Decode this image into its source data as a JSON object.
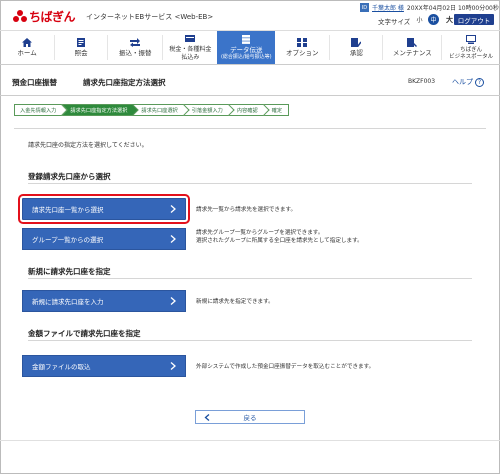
{
  "header": {
    "logo_text": "ちばぎん",
    "service_name": "インターネットEBサービス <Web-EB>",
    "user_icon": "ID",
    "user_name": "千葉太郎 様",
    "login_time": "20XX年04月02日 10時00分00秒",
    "font_size_label": "文字サイズ",
    "font_small": "小",
    "font_medium": "中",
    "font_large": "大",
    "logout": "ログアウト"
  },
  "nav": {
    "items": [
      {
        "label": "ホーム",
        "icon": "home-icon"
      },
      {
        "label": "照会",
        "icon": "inquiry-icon"
      },
      {
        "label": "振込・振替",
        "icon": "transfer-icon"
      },
      {
        "label": "税金・各種料金\n払込み",
        "icon": "tax-payment-icon"
      },
      {
        "label": "データ伝送",
        "sub": "(総合振込/給与振込等)",
        "icon": "data-transfer-icon",
        "active": true
      },
      {
        "label": "オプション",
        "icon": "option-icon"
      },
      {
        "label": "承認",
        "icon": "approval-icon"
      },
      {
        "label": "メンテナンス",
        "icon": "maintenance-icon"
      },
      {
        "label": "ちばぎん\nビジネスポータル",
        "icon": "portal-icon"
      }
    ]
  },
  "title_bar": {
    "category": "預金口座振替",
    "title": "請求先口座指定方法選択",
    "screen_id": "BKZF003",
    "help": "ヘルプ"
  },
  "steps": [
    {
      "label": "入金先情報入力",
      "current": false
    },
    {
      "label": "請求先口座指定方法選択",
      "current": true
    },
    {
      "label": "請求先口座選択",
      "current": false
    },
    {
      "label": "引落金額入力",
      "current": false
    },
    {
      "label": "内容確認",
      "current": false
    },
    {
      "label": "確定",
      "current": false
    }
  ],
  "instruction": "請求先口座の指定方法を選択してください。",
  "sections": {
    "registered": {
      "title": "登録請求先口座から選択",
      "btn_list": "請求先口座一覧から選択",
      "desc_list": "請求先一覧から請求先を選択できます。",
      "btn_group": "グループ一覧からの選択",
      "desc_group_1": "請求先グループ一覧からグループを選択できます。",
      "desc_group_2": "選択されたグループに所属する全口座を請求先として指定します。"
    },
    "new": {
      "title": "新規に請求先口座を指定",
      "btn": "新規に請求先口座を入力",
      "desc": "新規に請求先を指定できます。"
    },
    "file": {
      "title": "金額ファイルで請求先口座を指定",
      "btn": "金額ファイルの取込",
      "desc": "外部システムで作成した預金口座振替データを取込むことができます。"
    }
  },
  "back": "戻る",
  "colors": {
    "brand_red": "#d7000f",
    "nav_active": "#3b74c9",
    "button_blue": "#3566b8",
    "step_green": "#2e8a3c",
    "highlight_red": "#e3101b"
  }
}
